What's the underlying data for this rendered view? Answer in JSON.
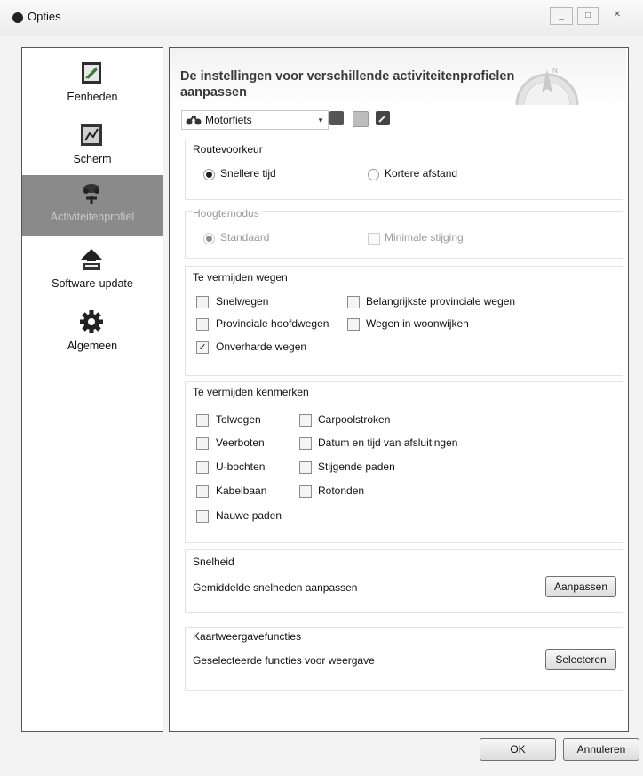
{
  "window": {
    "title": "Opties",
    "controls": {
      "minimize": "_",
      "maximize": "□",
      "close": "✕"
    }
  },
  "sidebar": {
    "items": [
      {
        "label": "Eenheden",
        "icon": "ruler-book-icon",
        "active": false
      },
      {
        "label": "Scherm",
        "icon": "screen-icon",
        "active": false
      },
      {
        "label": "Activiteitenprofiel",
        "icon": "motorbike-icon",
        "active": true
      },
      {
        "label": "Software-update",
        "icon": "update-icon",
        "active": false
      },
      {
        "label": "Algemeen",
        "icon": "gear-icon",
        "active": false
      }
    ]
  },
  "main": {
    "heading": "De instellingen voor verschillende activiteitenprofielen aanpassen",
    "profile": {
      "selected": "Motorfiets",
      "icon": "motorbike-icon"
    },
    "toolbar_icons": [
      "profile-info-icon",
      "profile-copy-icon",
      "profile-edit-icon"
    ],
    "route_pref": {
      "title": "Routevoorkeur",
      "options": [
        {
          "label": "Snellere tijd",
          "selected": true
        },
        {
          "label": "Kortere afstand",
          "selected": false
        }
      ]
    },
    "elevation": {
      "title": "Hoogtemodus",
      "options": [
        {
          "label": "Standaard",
          "selected": true
        },
        {
          "label": "Minimale stijging",
          "selected": false
        }
      ]
    },
    "avoid_roads": {
      "title": "Te vermijden wegen",
      "items": [
        {
          "label": "Snelwegen",
          "checked": false
        },
        {
          "label": "Belangrijkste provinciale wegen",
          "checked": false
        },
        {
          "label": "Provinciale hoofdwegen",
          "checked": false
        },
        {
          "label": "Wegen in woonwijken",
          "checked": false
        },
        {
          "label": "Onverharde wegen",
          "checked": true
        }
      ]
    },
    "avoid_features": {
      "title": "Te vermijden kenmerken",
      "items": [
        {
          "label": "Tolwegen",
          "checked": false
        },
        {
          "label": "Carpoolstroken",
          "checked": false
        },
        {
          "label": "Veerboten",
          "checked": false
        },
        {
          "label": "Datum en tijd van afsluitingen",
          "checked": false
        },
        {
          "label": "U-bochten",
          "checked": false
        },
        {
          "label": "Stijgende paden",
          "checked": false
        },
        {
          "label": "Kabelbaan",
          "checked": false
        },
        {
          "label": "Rotonden",
          "checked": false
        },
        {
          "label": "Nauwe paden",
          "checked": false
        }
      ]
    },
    "speed": {
      "title": "Snelheid",
      "description": "Gemiddelde snelheden aanpassen",
      "button": "Aanpassen"
    },
    "map_features": {
      "title": "Kaartweergavefuncties",
      "description": "Geselecteerde functies voor weergave",
      "button": "Selecteren"
    }
  },
  "footer": {
    "ok": "OK",
    "cancel": "Annuleren"
  },
  "colors": {
    "active_nav": "#8a8a8a",
    "panel_border": "#555555"
  }
}
